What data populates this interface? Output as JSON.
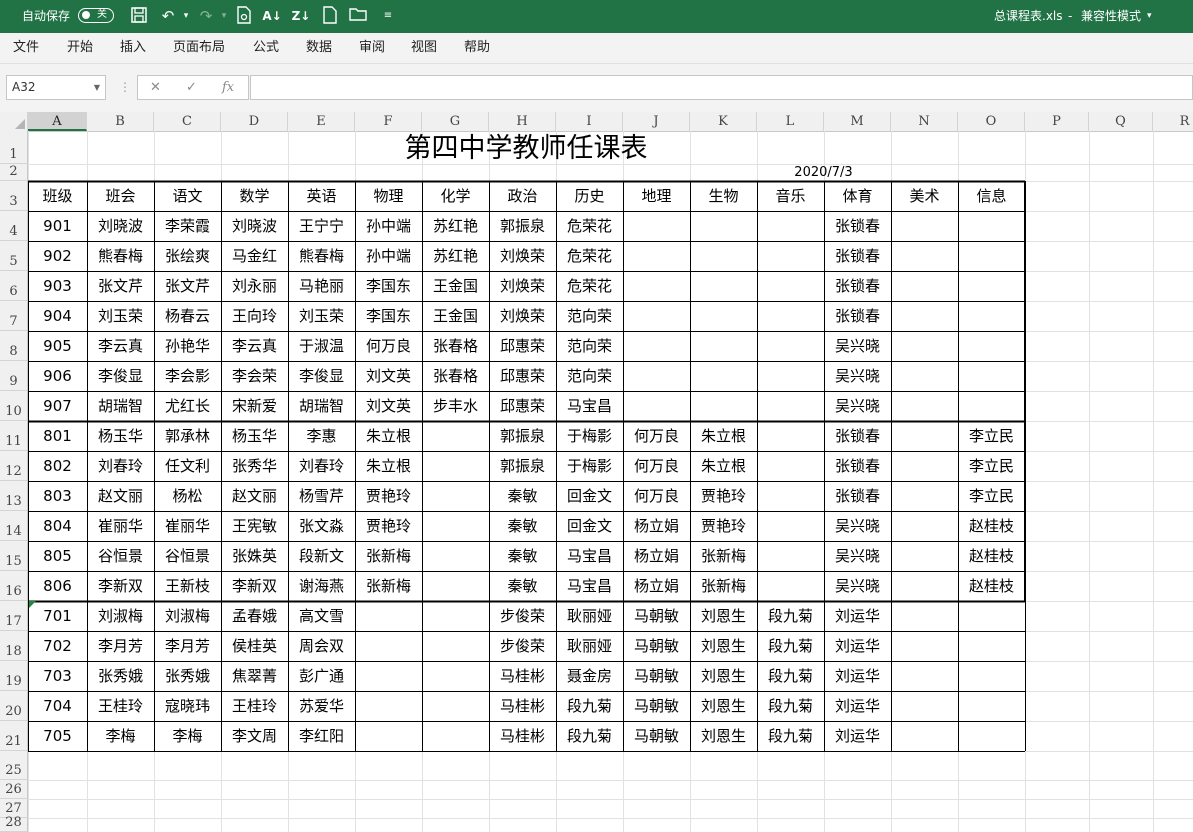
{
  "titlebar": {
    "autosave_label": "自动保存",
    "autosave_state": "关",
    "doc_title": "总课程表.xls",
    "separator": "-",
    "mode": "兼容性模式",
    "bg_color": "#217346"
  },
  "menu": [
    "文件",
    "开始",
    "插入",
    "页面布局",
    "公式",
    "数据",
    "审阅",
    "视图",
    "帮助"
  ],
  "formula_bar": {
    "name_box": "A32",
    "fx_label": "fx",
    "value": ""
  },
  "columns": [
    "A",
    "B",
    "C",
    "D",
    "E",
    "F",
    "G",
    "H",
    "I",
    "J",
    "K",
    "L",
    "M",
    "N",
    "O",
    "P",
    "Q",
    "R"
  ],
  "selected_column": "A",
  "row_numbers": [
    "1",
    "2",
    "3",
    "4",
    "5",
    "6",
    "7",
    "8",
    "9",
    "10",
    "11",
    "12",
    "13",
    "14",
    "15",
    "16",
    "17",
    "18",
    "19",
    "20",
    "21",
    "25",
    "26",
    "27",
    "28"
  ],
  "sheet": {
    "title": "第四中学教师任课表",
    "date": "2020/7/3",
    "headers": [
      "班级",
      "班会",
      "语文",
      "数学",
      "英语",
      "物理",
      "化学",
      "政治",
      "历史",
      "地理",
      "生物",
      "音乐",
      "体育",
      "美术",
      "信息"
    ],
    "rows": [
      [
        "901",
        "刘晓波",
        "李荣霞",
        "刘晓波",
        "王宁宁",
        "孙中端",
        "苏红艳",
        "郭振泉",
        "危荣花",
        "",
        "",
        "",
        "张锁春",
        "",
        ""
      ],
      [
        "902",
        "熊春梅",
        "张绘爽",
        "马金红",
        "熊春梅",
        "孙中端",
        "苏红艳",
        "刘焕荣",
        "危荣花",
        "",
        "",
        "",
        "张锁春",
        "",
        ""
      ],
      [
        "903",
        "张文芹",
        "张文芹",
        "刘永丽",
        "马艳丽",
        "李国东",
        "王金国",
        "刘焕荣",
        "危荣花",
        "",
        "",
        "",
        "张锁春",
        "",
        ""
      ],
      [
        "904",
        "刘玉荣",
        "杨春云",
        "王向玲",
        "刘玉荣",
        "李国东",
        "王金国",
        "刘焕荣",
        "范向荣",
        "",
        "",
        "",
        "张锁春",
        "",
        ""
      ],
      [
        "905",
        "李云真",
        "孙艳华",
        "李云真",
        "于淑温",
        "何万良",
        "张春格",
        "邱惠荣",
        "范向荣",
        "",
        "",
        "",
        "吴兴晓",
        "",
        ""
      ],
      [
        "906",
        "李俊显",
        "李会影",
        "李会荣",
        "李俊显",
        "刘文英",
        "张春格",
        "邱惠荣",
        "范向荣",
        "",
        "",
        "",
        "吴兴晓",
        "",
        ""
      ],
      [
        "907",
        "胡瑞智",
        "尤红长",
        "宋新爱",
        "胡瑞智",
        "刘文英",
        "步丰水",
        "邱惠荣",
        "马宝昌",
        "",
        "",
        "",
        "吴兴晓",
        "",
        ""
      ],
      [
        "801",
        "杨玉华",
        "郭承林",
        "杨玉华",
        "李惠",
        "朱立根",
        "",
        "郭振泉",
        "于梅影",
        "何万良",
        "朱立根",
        "",
        "张锁春",
        "",
        "李立民"
      ],
      [
        "802",
        "刘春玲",
        "任文利",
        "张秀华",
        "刘春玲",
        "朱立根",
        "",
        "郭振泉",
        "于梅影",
        "何万良",
        "朱立根",
        "",
        "张锁春",
        "",
        "李立民"
      ],
      [
        "803",
        "赵文丽",
        "杨松",
        "赵文丽",
        "杨雪芹",
        "贾艳玲",
        "",
        "秦敏",
        "回金文",
        "何万良",
        "贾艳玲",
        "",
        "张锁春",
        "",
        "李立民"
      ],
      [
        "804",
        "崔丽华",
        "崔丽华",
        "王宪敏",
        "张文淼",
        "贾艳玲",
        "",
        "秦敏",
        "回金文",
        "杨立娟",
        "贾艳玲",
        "",
        "吴兴晓",
        "",
        "赵桂枝"
      ],
      [
        "805",
        "谷恒景",
        "谷恒景",
        "张姝英",
        "段新文",
        "张新梅",
        "",
        "秦敏",
        "马宝昌",
        "杨立娟",
        "张新梅",
        "",
        "吴兴晓",
        "",
        "赵桂枝"
      ],
      [
        "806",
        "李新双",
        "王新枝",
        "李新双",
        "谢海燕",
        "张新梅",
        "",
        "秦敏",
        "马宝昌",
        "杨立娟",
        "张新梅",
        "",
        "吴兴晓",
        "",
        "赵桂枝"
      ],
      [
        "701",
        "刘淑梅",
        "刘淑梅",
        "孟春娥",
        "高文雪",
        "",
        "",
        "步俊荣",
        "耿丽娅",
        "马朝敏",
        "刘恩生",
        "段九菊",
        "刘运华",
        "",
        ""
      ],
      [
        "702",
        "李月芳",
        "李月芳",
        "侯桂英",
        "周会双",
        "",
        "",
        "步俊荣",
        "耿丽娅",
        "马朝敏",
        "刘恩生",
        "段九菊",
        "刘运华",
        "",
        ""
      ],
      [
        "703",
        "张秀娥",
        "张秀娥",
        "焦翠菁",
        "彭广通",
        "",
        "",
        "马桂彬",
        "聂金房",
        "马朝敏",
        "刘恩生",
        "段九菊",
        "刘运华",
        "",
        ""
      ],
      [
        "704",
        "王桂玲",
        "寇晓玮",
        "王桂玲",
        "苏爱华",
        "",
        "",
        "马桂彬",
        "段九菊",
        "马朝敏",
        "刘恩生",
        "段九菊",
        "刘运华",
        "",
        ""
      ],
      [
        "705",
        "李梅",
        "李梅",
        "李文周",
        "李红阳",
        "",
        "",
        "马桂彬",
        "段九菊",
        "马朝敏",
        "刘恩生",
        "段九菊",
        "刘运华",
        "",
        ""
      ]
    ]
  }
}
